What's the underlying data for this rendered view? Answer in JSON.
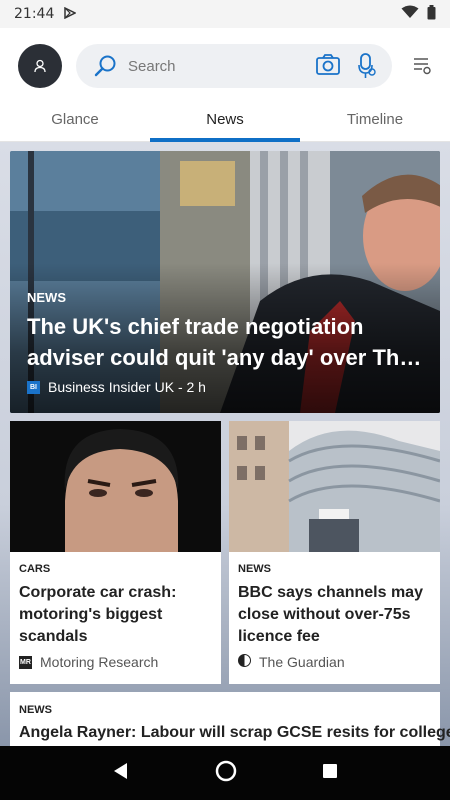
{
  "status_bar": {
    "time": "21:44"
  },
  "search": {
    "placeholder": "Search"
  },
  "tabs": [
    {
      "label": "Glance",
      "active": false
    },
    {
      "label": "News",
      "active": true
    },
    {
      "label": "Timeline",
      "active": false
    }
  ],
  "hero": {
    "category": "NEWS",
    "headline": "The UK's chief trade negotiation adviser could quit 'any day' over Th…",
    "source": "Business Insider UK - 2 h",
    "source_badge": "BI"
  },
  "cards": [
    {
      "category": "CARS",
      "headline": "Corporate car crash: motoring's biggest scandals",
      "source": "Motoring Research",
      "source_badge": "MR"
    },
    {
      "category": "NEWS",
      "headline": "BBC says channels may close without over-75s licence fee",
      "source": "The Guardian"
    }
  ],
  "wide_card": {
    "category": "NEWS",
    "headline": "Angela Rayner: Labour will scrap GCSE resits for college"
  },
  "colors": {
    "accent": "#0f6fc6",
    "search_bg": "#eef0f3",
    "nav_bar": "#050505"
  }
}
